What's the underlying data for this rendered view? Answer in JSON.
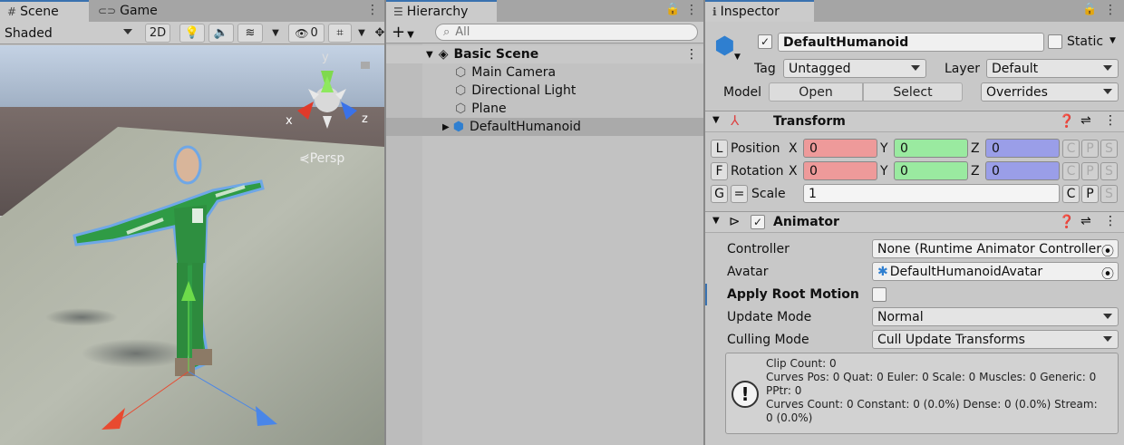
{
  "scene_panel": {
    "tabs": [
      {
        "label": "Scene",
        "icon": "grid-icon"
      },
      {
        "label": "Game",
        "icon": "gamepad-icon"
      }
    ],
    "toolbar": {
      "shading_mode": "Shaded",
      "toggle_2d": "2D",
      "hidden_count": "0"
    },
    "gizmo": {
      "y": "y",
      "x": "x",
      "z": "z",
      "persp": "Persp"
    }
  },
  "hierarchy": {
    "tab": "Hierarchy",
    "search_placeholder": "All",
    "scene_name": "Basic Scene",
    "items": [
      {
        "label": "Main Camera",
        "icon": "cube-icon"
      },
      {
        "label": "Directional Light",
        "icon": "cube-icon"
      },
      {
        "label": "Plane",
        "icon": "cube-icon"
      },
      {
        "label": "DefaultHumanoid",
        "icon": "prefab-icon",
        "selected": true
      }
    ]
  },
  "inspector": {
    "tab": "Inspector",
    "object_name": "DefaultHumanoid",
    "static_label": "Static",
    "tag_label": "Tag",
    "tag_value": "Untagged",
    "layer_label": "Layer",
    "layer_value": "Default",
    "model_label": "Model",
    "open_button": "Open",
    "select_button": "Select",
    "overrides_value": "Overrides",
    "transform": {
      "title": "Transform",
      "position_key": "L",
      "position_label": "Position",
      "rotation_key": "F",
      "rotation_label": "Rotation",
      "scale_key": "G",
      "scale_link": "=",
      "scale_label": "Scale",
      "axis_x": "X",
      "axis_y": "Y",
      "axis_z": "Z",
      "position": {
        "x": "0",
        "y": "0",
        "z": "0"
      },
      "rotation": {
        "x": "0",
        "y": "0",
        "z": "0"
      },
      "scale": "1",
      "cps": [
        "C",
        "P",
        "S"
      ]
    },
    "animator": {
      "title": "Animator",
      "controller_label": "Controller",
      "controller_value": "None (Runtime Animator Controller)",
      "avatar_label": "Avatar",
      "avatar_value": "DefaultHumanoidAvatar",
      "root_motion_label": "Apply Root Motion",
      "update_mode_label": "Update Mode",
      "update_mode_value": "Normal",
      "culling_mode_label": "Culling Mode",
      "culling_mode_value": "Cull Update Transforms",
      "info_lines": [
        "Clip Count: 0",
        "Curves Pos: 0 Quat: 0 Euler: 0 Scale: 0 Muscles: 0 Generic: 0",
        "PPtr: 0",
        "Curves Count: 0 Constant: 0 (0.0%) Dense: 0 (0.0%) Stream:",
        "0 (0.0%)"
      ]
    }
  },
  "colors": {
    "x_field": "#ee9a9a",
    "y_field": "#9aeaa0",
    "z_field": "#9a9ee8",
    "selection": "#a8a8a8",
    "accent": "#3a72b0"
  }
}
